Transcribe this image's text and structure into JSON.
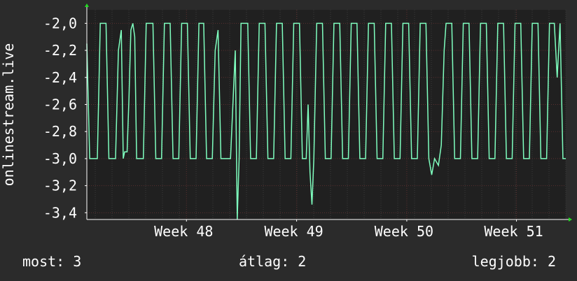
{
  "chart_data": {
    "type": "line",
    "ylabel": "onlinestream.live",
    "ylim": [
      -3.45,
      -1.9
    ],
    "y_ticks": [
      -2.0,
      -2.2,
      -2.4,
      -2.6,
      -2.8,
      -3.0,
      -3.2,
      -3.4
    ],
    "y_tick_labels": [
      "-2,0",
      "-2,2",
      "-2,4",
      "-2,6",
      "-2,8",
      "-3,0",
      "-3,2",
      "-3,4"
    ],
    "x_tick_labels": [
      "Week 48",
      "Week 49",
      "Week 50",
      "Week 51"
    ],
    "x_tick_positions": [
      0.208,
      0.438,
      0.668,
      0.897
    ],
    "grid": true,
    "series": [
      {
        "color": "#7fffbf",
        "pattern_note": "daily oscillation between -2.0 and -3.0",
        "points": [
          [
            0.0,
            -2.15
          ],
          [
            0.006,
            -3.0
          ],
          [
            0.022,
            -3.0
          ],
          [
            0.028,
            -2.0
          ],
          [
            0.04,
            -2.0
          ],
          [
            0.046,
            -3.0
          ],
          [
            0.06,
            -3.0
          ],
          [
            0.066,
            -2.2
          ],
          [
            0.072,
            -2.05
          ],
          [
            0.076,
            -3.0
          ],
          [
            0.079,
            -2.95
          ],
          [
            0.084,
            -2.95
          ],
          [
            0.088,
            -2.55
          ],
          [
            0.092,
            -2.05
          ],
          [
            0.096,
            -2.0
          ],
          [
            0.1,
            -2.1
          ],
          [
            0.104,
            -3.0
          ],
          [
            0.118,
            -3.0
          ],
          [
            0.124,
            -2.0
          ],
          [
            0.138,
            -2.0
          ],
          [
            0.144,
            -3.0
          ],
          [
            0.156,
            -3.0
          ],
          [
            0.162,
            -2.0
          ],
          [
            0.174,
            -2.0
          ],
          [
            0.18,
            -3.0
          ],
          [
            0.192,
            -3.0
          ],
          [
            0.198,
            -2.0
          ],
          [
            0.21,
            -2.0
          ],
          [
            0.216,
            -3.0
          ],
          [
            0.228,
            -3.0
          ],
          [
            0.234,
            -2.0
          ],
          [
            0.244,
            -2.0
          ],
          [
            0.25,
            -3.0
          ],
          [
            0.262,
            -3.0
          ],
          [
            0.268,
            -2.2
          ],
          [
            0.274,
            -2.05
          ],
          [
            0.28,
            -3.0
          ],
          [
            0.288,
            -3.0
          ],
          [
            0.3,
            -3.0
          ],
          [
            0.31,
            -2.2
          ],
          [
            0.314,
            -3.45
          ],
          [
            0.318,
            -3.0
          ],
          [
            0.322,
            -2.0
          ],
          [
            0.336,
            -2.0
          ],
          [
            0.342,
            -3.0
          ],
          [
            0.354,
            -3.0
          ],
          [
            0.36,
            -2.0
          ],
          [
            0.372,
            -2.0
          ],
          [
            0.378,
            -3.0
          ],
          [
            0.39,
            -3.0
          ],
          [
            0.396,
            -2.0
          ],
          [
            0.408,
            -2.0
          ],
          [
            0.414,
            -3.0
          ],
          [
            0.426,
            -3.0
          ],
          [
            0.432,
            -2.0
          ],
          [
            0.444,
            -2.0
          ],
          [
            0.45,
            -3.0
          ],
          [
            0.458,
            -3.0
          ],
          [
            0.462,
            -2.6
          ],
          [
            0.466,
            -3.1
          ],
          [
            0.47,
            -3.34
          ],
          [
            0.474,
            -3.0
          ],
          [
            0.48,
            -2.0
          ],
          [
            0.492,
            -2.0
          ],
          [
            0.498,
            -3.0
          ],
          [
            0.51,
            -3.0
          ],
          [
            0.516,
            -2.0
          ],
          [
            0.528,
            -2.0
          ],
          [
            0.534,
            -3.0
          ],
          [
            0.546,
            -3.0
          ],
          [
            0.552,
            -2.0
          ],
          [
            0.564,
            -2.0
          ],
          [
            0.57,
            -3.0
          ],
          [
            0.582,
            -3.0
          ],
          [
            0.588,
            -2.0
          ],
          [
            0.6,
            -2.0
          ],
          [
            0.606,
            -3.0
          ],
          [
            0.618,
            -3.0
          ],
          [
            0.624,
            -2.0
          ],
          [
            0.636,
            -2.0
          ],
          [
            0.642,
            -3.0
          ],
          [
            0.654,
            -3.0
          ],
          [
            0.66,
            -2.0
          ],
          [
            0.672,
            -2.0
          ],
          [
            0.678,
            -3.0
          ],
          [
            0.69,
            -3.0
          ],
          [
            0.696,
            -2.0
          ],
          [
            0.708,
            -2.0
          ],
          [
            0.714,
            -3.0
          ],
          [
            0.72,
            -3.12
          ],
          [
            0.726,
            -3.0
          ],
          [
            0.734,
            -3.05
          ],
          [
            0.74,
            -2.9
          ],
          [
            0.746,
            -2.2
          ],
          [
            0.75,
            -2.0
          ],
          [
            0.762,
            -2.0
          ],
          [
            0.768,
            -3.0
          ],
          [
            0.78,
            -3.0
          ],
          [
            0.786,
            -2.0
          ],
          [
            0.798,
            -2.0
          ],
          [
            0.804,
            -3.0
          ],
          [
            0.816,
            -3.0
          ],
          [
            0.822,
            -2.0
          ],
          [
            0.834,
            -2.0
          ],
          [
            0.84,
            -3.0
          ],
          [
            0.852,
            -3.0
          ],
          [
            0.858,
            -2.0
          ],
          [
            0.87,
            -2.0
          ],
          [
            0.876,
            -3.0
          ],
          [
            0.888,
            -3.0
          ],
          [
            0.894,
            -2.0
          ],
          [
            0.906,
            -2.0
          ],
          [
            0.912,
            -3.0
          ],
          [
            0.924,
            -3.0
          ],
          [
            0.93,
            -2.0
          ],
          [
            0.942,
            -2.0
          ],
          [
            0.948,
            -3.0
          ],
          [
            0.96,
            -3.0
          ],
          [
            0.966,
            -2.0
          ],
          [
            0.976,
            -2.0
          ],
          [
            0.982,
            -2.4
          ],
          [
            0.988,
            -2.0
          ],
          [
            0.994,
            -3.0
          ],
          [
            1.0,
            -3.0
          ]
        ]
      }
    ]
  },
  "footer": {
    "now_label": "most:",
    "now_value": "3",
    "avg_label": "átlag:",
    "avg_value": "2",
    "best_label": "legjobb:",
    "best_value": "2"
  },
  "colors": {
    "background": "#2b2b2b",
    "plot_background": "#202020",
    "grid": "#5a2f2f",
    "axis": "#ffffff",
    "arrow": "#22dd22",
    "line": "#7fffbf"
  }
}
